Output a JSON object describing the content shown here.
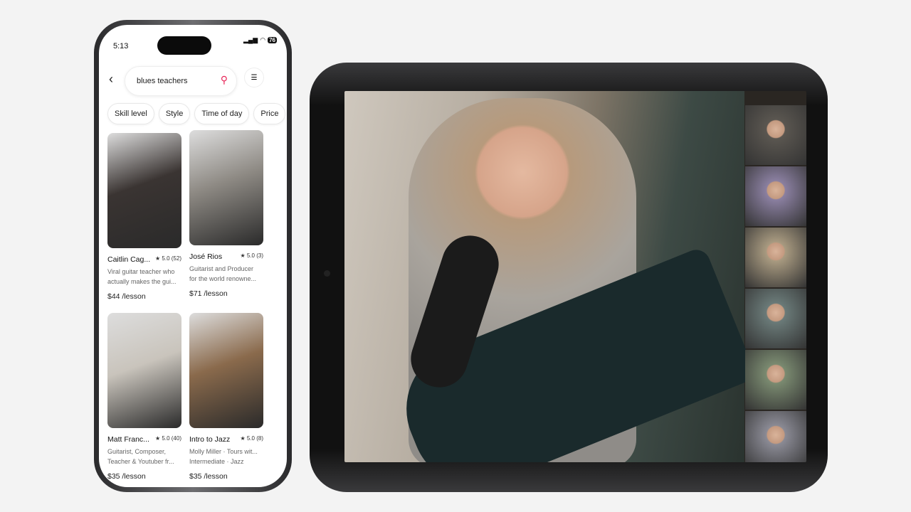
{
  "phone": {
    "status": {
      "time": "5:13",
      "battery": "76"
    },
    "search": {
      "query": "blues teachers"
    },
    "filters": [
      "Skill level",
      "Style",
      "Time of day",
      "Price"
    ],
    "cards": [
      {
        "name": "Caitlin Cag...",
        "rating": "★ 5.0 (52)",
        "desc1": "Viral guitar teacher who",
        "desc2": "actually makes the gui...",
        "price": "$44 /lesson",
        "color": "#3a3432"
      },
      {
        "name": "José Rios",
        "rating": "★ 5.0 (3)",
        "desc1": "Guitarist and Producer",
        "desc2": "for the world renowne...",
        "price": "$71 /lesson",
        "color": "#8e8a84"
      },
      {
        "name": "Matt Franc...",
        "rating": "★ 5.0 (40)",
        "desc1": "Guitarist, Composer,",
        "desc2": "Teacher & Youtuber fr...",
        "price": "$35 /lesson",
        "color": "#c9c4bc"
      },
      {
        "name": "Intro to Jazz",
        "rating": "★ 5.0 (8)",
        "desc1": "Molly Miller · Tours wit...",
        "desc2": "Intermediate · Jazz",
        "price": "$35 /lesson",
        "color": "#8a6a4c"
      }
    ]
  },
  "tablet": {
    "participant_tiles": [
      "#5a5650",
      "#8a7fa0",
      "#a89a80",
      "#6a7a78",
      "#7a8a70",
      "#8a8a94"
    ]
  },
  "colors": {
    "accent": "#e8285a",
    "background": "#f3f3f3"
  }
}
